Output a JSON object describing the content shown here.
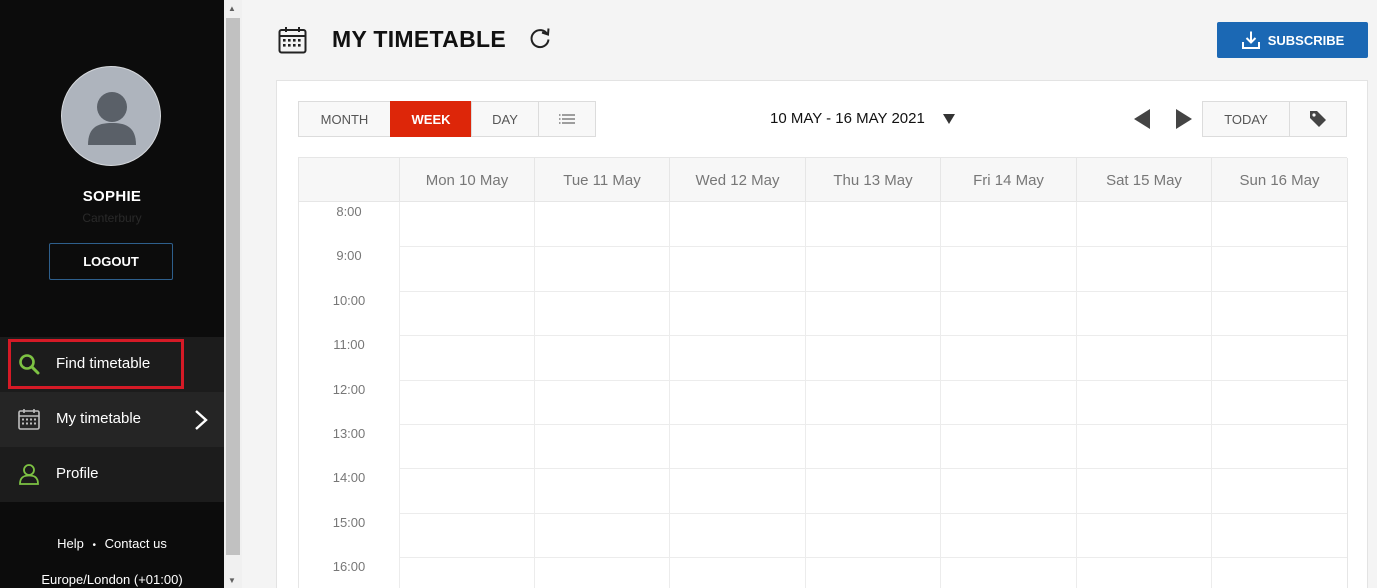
{
  "sidebar": {
    "user": {
      "name": "SOPHIE",
      "subtitle": "Canterbury"
    },
    "logout_label": "LOGOUT",
    "nav": {
      "find": {
        "label": "Find timetable",
        "icon": "search-icon"
      },
      "my": {
        "label": "My timetable",
        "icon": "calendar-icon"
      },
      "profile": {
        "label": "Profile",
        "icon": "user-icon"
      }
    },
    "footer": {
      "help": "Help",
      "separator": "•",
      "contact": "Contact us",
      "timezone": "Europe/London (+01:00)"
    }
  },
  "header": {
    "title": "MY TIMETABLE",
    "subscribe_label": "SUBSCRIBE"
  },
  "toolbar": {
    "views": {
      "month": "MONTH",
      "week": "WEEK",
      "day": "DAY"
    },
    "date_range": "10 MAY - 16 MAY 2021",
    "today_label": "TODAY"
  },
  "calendar": {
    "days": [
      "Mon 10 May",
      "Tue 11 May",
      "Wed 12 May",
      "Thu 13 May",
      "Fri 14 May",
      "Sat 15 May",
      "Sun 16 May"
    ],
    "times": [
      "8:00",
      "9:00",
      "10:00",
      "11:00",
      "12:00",
      "13:00",
      "14:00",
      "15:00",
      "16:00"
    ]
  },
  "colors": {
    "accent_green": "#7dc243",
    "active_red": "#dd2609",
    "subscribe_blue": "#1b68b4",
    "highlight_red": "#d51a26"
  }
}
